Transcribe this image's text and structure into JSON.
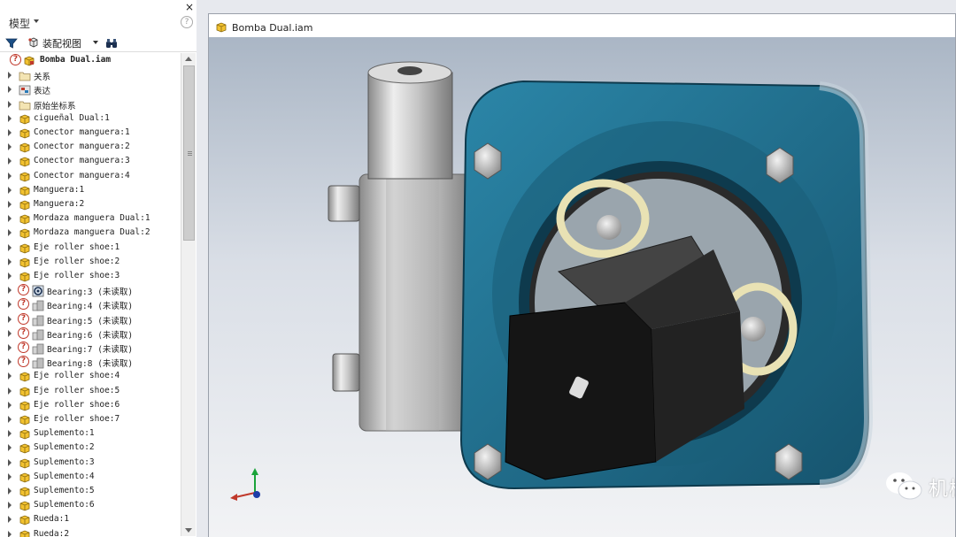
{
  "panel": {
    "close": "×",
    "title": "模型",
    "help": "?",
    "toolbar": {
      "view_label": "装配视图"
    }
  },
  "tree": {
    "root": "Bomba Dual.iam",
    "items": [
      {
        "label": "关系",
        "icon": "folder"
      },
      {
        "label": "表达",
        "icon": "representation"
      },
      {
        "label": "原始坐标系",
        "icon": "folder"
      },
      {
        "label": "cigueñal Dual:1",
        "icon": "part"
      },
      {
        "label": "Conector manguera:1",
        "icon": "part"
      },
      {
        "label": "Conector manguera:2",
        "icon": "part"
      },
      {
        "label": "Conector manguera:3",
        "icon": "part"
      },
      {
        "label": "Conector manguera:4",
        "icon": "part"
      },
      {
        "label": "Manguera:1",
        "icon": "part"
      },
      {
        "label": "Manguera:2",
        "icon": "part"
      },
      {
        "label": "Mordaza manguera Dual:1",
        "icon": "part"
      },
      {
        "label": "Mordaza manguera Dual:2",
        "icon": "part"
      },
      {
        "label": "Eje roller shoe:1",
        "icon": "part"
      },
      {
        "label": "Eje roller shoe:2",
        "icon": "part"
      },
      {
        "label": "Eje roller shoe:3",
        "icon": "part"
      },
      {
        "label": "Bearing:3 (未读取)",
        "icon": "bearing",
        "unresolved": true
      },
      {
        "label": "Bearing:4 (未读取)",
        "icon": "bearing-gray",
        "unresolved": true
      },
      {
        "label": "Bearing:5 (未读取)",
        "icon": "bearing-gray",
        "unresolved": true
      },
      {
        "label": "Bearing:6 (未读取)",
        "icon": "bearing-gray",
        "unresolved": true
      },
      {
        "label": "Bearing:7 (未读取)",
        "icon": "bearing-gray",
        "unresolved": true
      },
      {
        "label": "Bearing:8 (未读取)",
        "icon": "bearing-gray",
        "unresolved": true
      },
      {
        "label": "Eje roller shoe:4",
        "icon": "part"
      },
      {
        "label": "Eje roller shoe:5",
        "icon": "part"
      },
      {
        "label": "Eje roller shoe:6",
        "icon": "part"
      },
      {
        "label": "Eje roller shoe:7",
        "icon": "part"
      },
      {
        "label": "Suplemento:1",
        "icon": "part"
      },
      {
        "label": "Suplemento:2",
        "icon": "part"
      },
      {
        "label": "Suplemento:3",
        "icon": "part"
      },
      {
        "label": "Suplemento:4",
        "icon": "part"
      },
      {
        "label": "Suplemento:5",
        "icon": "part"
      },
      {
        "label": "Suplemento:6",
        "icon": "part"
      },
      {
        "label": "Rueda:1",
        "icon": "part"
      },
      {
        "label": "Rueda:2",
        "icon": "part"
      }
    ]
  },
  "document": {
    "title": "Bomba Dual.iam"
  },
  "watermark": {
    "text": "机械图纸狗"
  },
  "colors": {
    "pump_body": "#1f6f8f",
    "motor": "#1a1a1a",
    "panel_bg": "#ffffff",
    "warning": "#c0392b",
    "part_icon": "#f2c230"
  }
}
